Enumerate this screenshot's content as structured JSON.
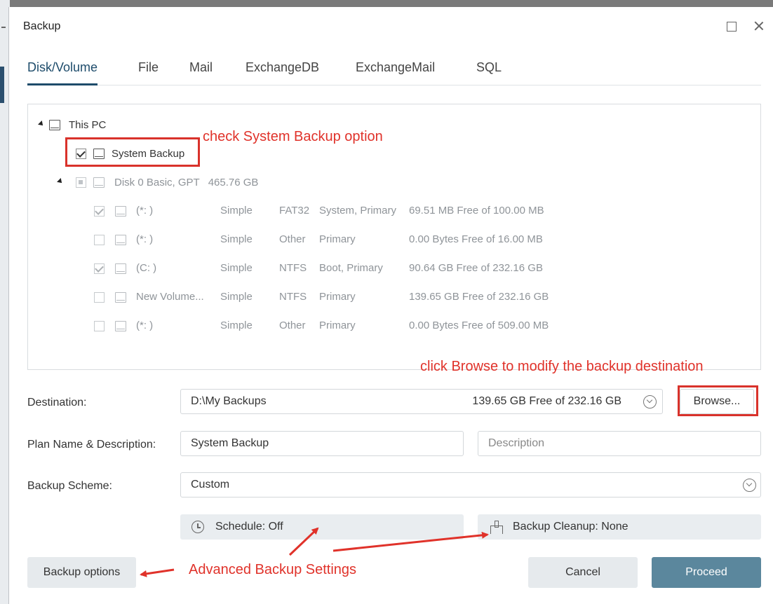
{
  "window": {
    "title": "Backup"
  },
  "tabs": [
    {
      "label": "Disk/Volume",
      "active": true
    },
    {
      "label": "File",
      "active": false
    },
    {
      "label": "Mail",
      "active": false
    },
    {
      "label": "ExchangeDB",
      "active": false
    },
    {
      "label": "ExchangeMail",
      "active": false
    },
    {
      "label": "SQL",
      "active": false
    }
  ],
  "tree": {
    "root": "This PC",
    "system_backup": {
      "label": "System Backup",
      "checked": true
    },
    "disk": {
      "label": "Disk 0 Basic, GPT",
      "size": "465.76 GB"
    },
    "partitions": [
      {
        "name": "(*: )",
        "type": "Simple",
        "fs": "FAT32",
        "role": "System, Primary",
        "space": "69.51 MB Free of 100.00 MB",
        "checked": true
      },
      {
        "name": "(*: )",
        "type": "Simple",
        "fs": "Other",
        "role": "Primary",
        "space": "0.00 Bytes Free of 16.00 MB",
        "checked": false
      },
      {
        "name": "(C: )",
        "type": "Simple",
        "fs": "NTFS",
        "role": "Boot, Primary",
        "space": "90.64 GB Free of 232.16 GB",
        "checked": true
      },
      {
        "name": "New Volume...",
        "type": "Simple",
        "fs": "NTFS",
        "role": "Primary",
        "space": "139.65 GB Free of 232.16 GB",
        "checked": false
      },
      {
        "name": "(*: )",
        "type": "Simple",
        "fs": "Other",
        "role": "Primary",
        "space": "0.00 Bytes Free of 509.00 MB",
        "checked": false
      }
    ]
  },
  "annotations": {
    "system_backup": "check System Backup option",
    "browse": "click Browse to modify the backup destination",
    "advanced": "Advanced Backup Settings"
  },
  "form": {
    "destination_label": "Destination:",
    "destination_value": "D:\\My Backups",
    "destination_free": "139.65 GB Free of 232.16 GB",
    "browse_label": "Browse...",
    "plan_label": "Plan Name & Description:",
    "plan_value": "System Backup",
    "description_placeholder": "Description",
    "scheme_label": "Backup Scheme:",
    "scheme_value": "Custom",
    "schedule_label": "Schedule: Off",
    "cleanup_label": "Backup Cleanup: None"
  },
  "footer": {
    "options_label": "Backup options",
    "cancel_label": "Cancel",
    "proceed_label": "Proceed"
  },
  "colors": {
    "accent": "#1e4c6b",
    "primary_button": "#5b879d",
    "annotation": "#e0322a"
  }
}
